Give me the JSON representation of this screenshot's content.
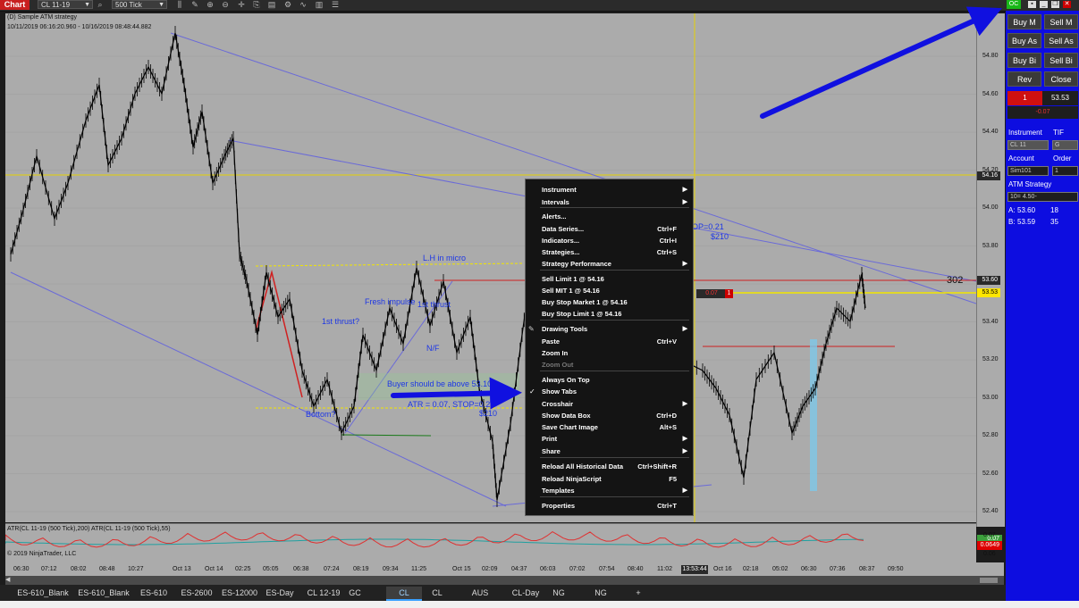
{
  "toolbar": {
    "chart_tab": "Chart",
    "instrument": "CL 11-19",
    "interval": "500 Tick"
  },
  "chart": {
    "title": "(D) Sample ATM strategy",
    "date_range": "10/11/2019 06:16:20.960 - 10/16/2019 08:48:44.882",
    "indicator_label": "ATR(CL 11-19 (500 Tick),200)  ATR(CL 11-19 (500 Tick),55)",
    "copyright": "© 2019 NinjaTrader, LLC",
    "y_ticks": [
      "54.80",
      "54.60",
      "54.40",
      "54.20",
      "54.00",
      "53.80",
      "53.60",
      "53.40",
      "53.20",
      "53.00",
      "52.80",
      "52.60",
      "52.40"
    ],
    "ind_ticks": [
      "0.07",
      "0.06"
    ],
    "x_ticks": [
      "06:30",
      "07:12",
      "08:02",
      "08:48",
      "10:27",
      "Oct 13",
      "Oct 14",
      "02:25",
      "05:05",
      "06:38",
      "07:24",
      "08:19",
      "09:34",
      "11:25",
      "Oct 15",
      "02:09",
      "04:37",
      "06:03",
      "07:02",
      "07:54",
      "08:40",
      "11:02",
      "Oct 16",
      "02:18",
      "05:02",
      "06:30",
      "07:36",
      "08:37",
      "09:50"
    ],
    "crosshair_time": "13:53:44",
    "price_markers": {
      "crosshair": "54.16",
      "last_red": "53.60",
      "last_yellow": "53.53",
      "ind_green": "0.07",
      "ind_red": "0.0649"
    },
    "bar_count_label": "302",
    "position_pnl": "0.07",
    "position_qty": "1",
    "annotations": {
      "lh_micro": "L.H in micro",
      "fresh_impulse": "Fresh impulse",
      "first_thrust_q": "1st thrust?",
      "first_thrust": "1st thrust",
      "nf": "N/F",
      "buyer_above": "Buyer should be above 53.10",
      "atr_stop": "ATR = 0.07, STOP=0.21",
      "dollars1": "$210",
      "bottom_q": "Bottom?",
      "stop_partial": "OP=0.21",
      "dollars2": "$210"
    }
  },
  "context_menu": {
    "items": [
      {
        "label": "Instrument",
        "shortcut": "",
        "submenu": true
      },
      {
        "label": "Intervals",
        "shortcut": "",
        "submenu": true
      },
      {
        "label": "Alerts...",
        "shortcut": "",
        "submenu": false
      },
      {
        "label": "Data Series...",
        "shortcut": "Ctrl+F",
        "submenu": false
      },
      {
        "label": "Indicators...",
        "shortcut": "Ctrl+I",
        "submenu": false
      },
      {
        "label": "Strategies...",
        "shortcut": "Ctrl+S",
        "submenu": false
      },
      {
        "label": "Strategy Performance",
        "shortcut": "",
        "submenu": true
      },
      {
        "label": "Sell Limit 1 @ 54.16",
        "shortcut": "",
        "submenu": false
      },
      {
        "label": "Sell MIT 1 @ 54.16",
        "shortcut": "",
        "submenu": false
      },
      {
        "label": "Buy Stop Market 1 @ 54.16",
        "shortcut": "",
        "submenu": false
      },
      {
        "label": "Buy Stop Limit 1 @ 54.16",
        "shortcut": "",
        "submenu": false
      },
      {
        "label": "Drawing Tools",
        "shortcut": "",
        "submenu": true
      },
      {
        "label": "Paste",
        "shortcut": "Ctrl+V",
        "submenu": false
      },
      {
        "label": "Zoom In",
        "shortcut": "",
        "submenu": false
      },
      {
        "label": "Zoom Out",
        "shortcut": "",
        "submenu": false
      },
      {
        "label": "Always On Top",
        "shortcut": "",
        "submenu": false
      },
      {
        "label": "Show Tabs",
        "shortcut": "",
        "submenu": false
      },
      {
        "label": "Crosshair",
        "shortcut": "",
        "submenu": true
      },
      {
        "label": "Show Data Box",
        "shortcut": "Ctrl+D",
        "submenu": false
      },
      {
        "label": "Save Chart Image",
        "shortcut": "Alt+S",
        "submenu": false
      },
      {
        "label": "Print",
        "shortcut": "",
        "submenu": true
      },
      {
        "label": "Share",
        "shortcut": "",
        "submenu": true
      },
      {
        "label": "Reload All Historical Data",
        "shortcut": "Ctrl+Shift+R",
        "submenu": false
      },
      {
        "label": "Reload NinjaScript",
        "shortcut": "F5",
        "submenu": false
      },
      {
        "label": "Templates",
        "shortcut": "",
        "submenu": true
      },
      {
        "label": "Properties",
        "shortcut": "Ctrl+T",
        "submenu": false
      }
    ]
  },
  "tabs": [
    "ES-610_Blank",
    "ES-610_Blank",
    "ES-610",
    "ES-2600",
    "ES-12000",
    "ES-Day",
    "CL 12-19",
    "GC",
    "CL",
    "CL",
    "AUS",
    "CL-Day",
    "NG",
    "NG",
    "+"
  ],
  "panel": {
    "oc": "OC",
    "buy_market": "Buy M",
    "sell_market": "Sell M",
    "buy_ask": "Buy As",
    "sell_ask": "Sell As",
    "buy_bid": "Buy Bi",
    "sell_bid": "Sell Bi",
    "reverse": "Rev",
    "close": "Close",
    "position_qty": "1",
    "position_price": "53.53",
    "unrealized": "-0.07",
    "instrument_label": "Instrument",
    "tif_label": "TIF",
    "instrument_value": "CL 11",
    "tif_value": "G",
    "account_label": "Account",
    "order_qty_label": "Order",
    "account_value": "Sim101",
    "order_qty_value": "1",
    "atm_label": "ATM Strategy",
    "atm_value": "10= 4.50-",
    "ask_label": "A:",
    "ask_price": "53.60",
    "ask_size": "18",
    "bid_label": "B:",
    "bid_price": "53.59",
    "bid_size": "35"
  },
  "colors": {
    "accent_arrow": "#1010e0",
    "price_up_marker": "#ffe600",
    "red_marker": "#cc0000"
  }
}
